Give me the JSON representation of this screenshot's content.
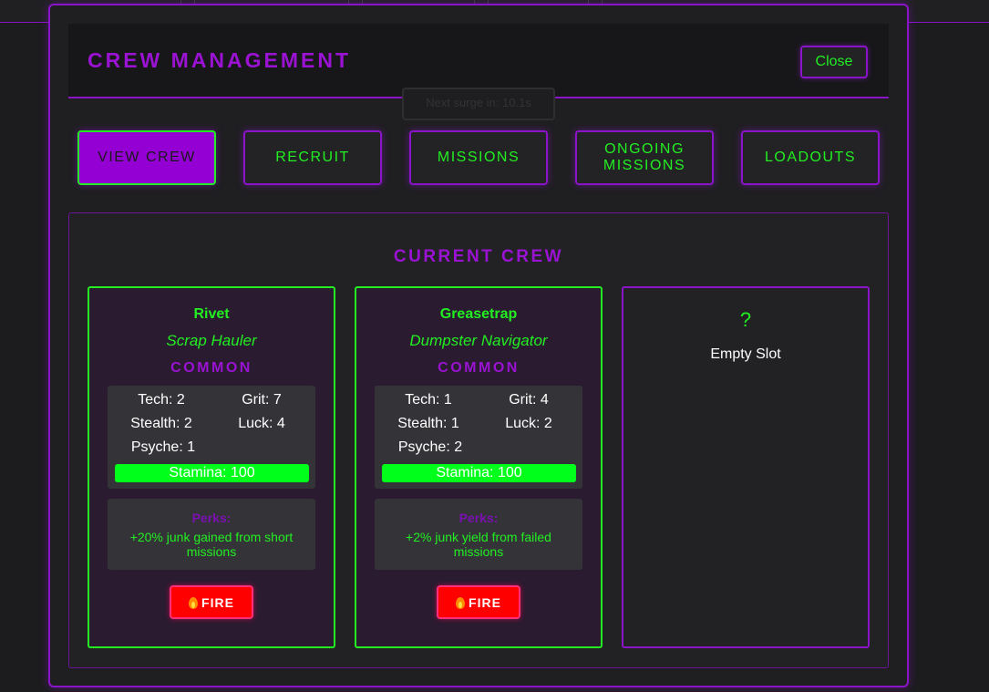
{
  "modal": {
    "title": "CREW MANAGEMENT",
    "close_label": "Close",
    "tooltip": "Next surge in: 10.1s"
  },
  "tabs": [
    {
      "label": "VIEW CREW",
      "active": true
    },
    {
      "label": "RECRUIT",
      "active": false
    },
    {
      "label": "MISSIONS",
      "active": false
    },
    {
      "label": "ONGOING MISSIONS",
      "active": false
    },
    {
      "label": "LOADOUTS",
      "active": false
    }
  ],
  "crew_panel": {
    "title": "CURRENT CREW",
    "members": [
      {
        "name": "Rivet",
        "role": "Scrap Hauler",
        "rarity": "COMMON",
        "stats": {
          "tech": "Tech: 2",
          "grit": "Grit: 7",
          "stealth": "Stealth: 2",
          "luck": "Luck: 4",
          "psyche": "Psyche: 1"
        },
        "stamina": "Stamina: 100",
        "stamina_value": 100,
        "perks_title": "Perks:",
        "perk": "+20% junk gained from short missions",
        "fire_label": "FIRE"
      },
      {
        "name": "Greasetrap",
        "role": "Dumpster Navigator",
        "rarity": "COMMON",
        "stats": {
          "tech": "Tech: 1",
          "grit": "Grit: 4",
          "stealth": "Stealth: 1",
          "luck": "Luck: 2",
          "psyche": "Psyche: 2"
        },
        "stamina": "Stamina: 100",
        "stamina_value": 100,
        "perks_title": "Perks:",
        "perk": "+2% junk yield from failed missions",
        "fire_label": "FIRE"
      }
    ],
    "empty_slot": {
      "icon": "?",
      "label": "Empty Slot"
    }
  },
  "colors": {
    "accent_purple": "#9400d3",
    "neon_green": "#22ee22",
    "danger_red": "#ff0000",
    "background": "#1c1c1e"
  }
}
